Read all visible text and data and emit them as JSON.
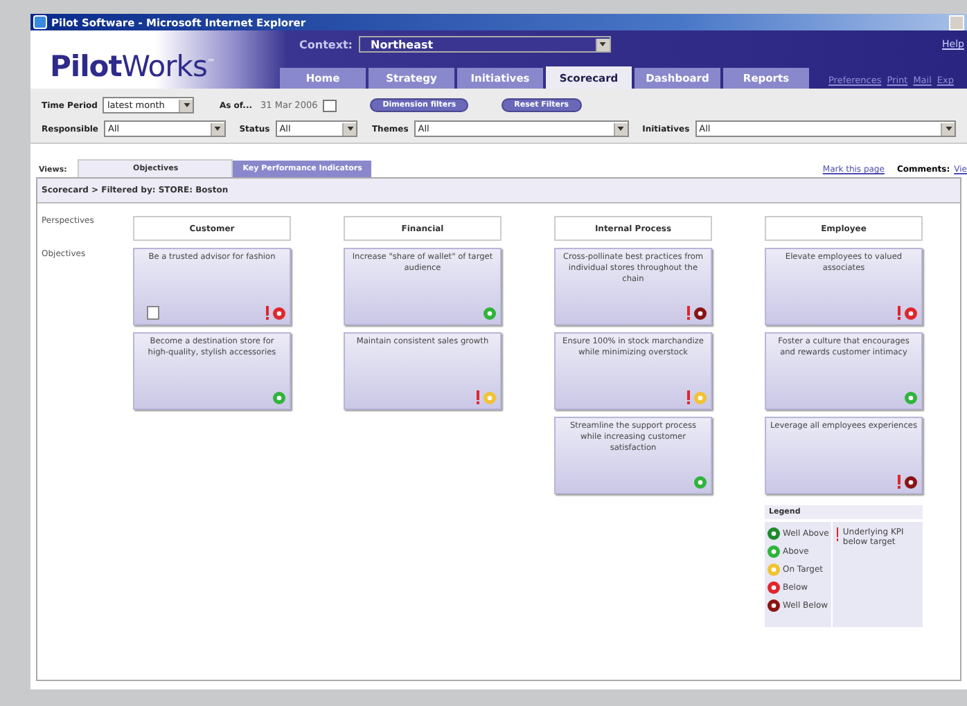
{
  "window": {
    "title": "Pilot Software - Microsoft Internet Explorer"
  },
  "header": {
    "logo_bold": "Pilot",
    "logo_light": "Works",
    "logo_mark": "™",
    "context_label": "Context:",
    "context_value": "Northeast",
    "help": "Help",
    "tabs": [
      {
        "label": "Home",
        "selected": false
      },
      {
        "label": "Strategy",
        "selected": false
      },
      {
        "label": "Initiatives",
        "selected": false
      },
      {
        "label": "Scorecard",
        "selected": true
      },
      {
        "label": "Dashboard",
        "selected": false
      },
      {
        "label": "Reports",
        "selected": false
      }
    ],
    "links": [
      "Preferences",
      "Print",
      "Mail",
      "Exp"
    ]
  },
  "filters": {
    "time_period": {
      "label": "Time Period",
      "value": "latest month"
    },
    "as_of": {
      "label": "As of...",
      "value": "31 Mar 2006"
    },
    "buttons": [
      "Dimension filters",
      "Reset Filters"
    ],
    "dropdowns": [
      {
        "label": "Responsible",
        "value": "All"
      },
      {
        "label": "Status",
        "value": "All"
      },
      {
        "label": "Themes",
        "value": "All"
      },
      {
        "label": "Initiatives",
        "value": "All"
      }
    ]
  },
  "views": {
    "label": "Views:",
    "tabs": [
      {
        "label": "Objectives",
        "selected": true
      },
      {
        "label": "Key Performance Indicators",
        "selected": false
      }
    ],
    "mark_link": "Mark this page",
    "comments_label": "Comments:",
    "comments_link": "Vie"
  },
  "breadcrumb": "Scorecard > Filtered by: STORE: Boston",
  "row_labels": [
    "Perspectives",
    "Objectives"
  ],
  "perspectives": [
    {
      "name": "Customer",
      "objectives": [
        {
          "text": "Be a trusted advisor for fashion",
          "note": true,
          "alert": true,
          "color": "#e0262c"
        },
        {
          "text": "Become a destination store for high-quality, stylish accessories",
          "note": false,
          "alert": false,
          "color": "#2fb43c"
        }
      ]
    },
    {
      "name": "Financial",
      "objectives": [
        {
          "text": "Increase \"share of wallet\" of target audience",
          "note": false,
          "alert": false,
          "color": "#2fb43c"
        },
        {
          "text": "Maintain consistent sales growth",
          "note": false,
          "alert": true,
          "color": "#f2c230"
        }
      ]
    },
    {
      "name": "Internal Process",
      "objectives": [
        {
          "text": "Cross-pollinate best practices from individual stores throughout the chain",
          "note": false,
          "alert": true,
          "color": "#8a1414"
        },
        {
          "text": "Ensure 100% in stock marchandize while minimizing overstock",
          "note": false,
          "alert": true,
          "color": "#f2c230"
        },
        {
          "text": "Streamline the support process while increasing customer satisfaction",
          "note": false,
          "alert": false,
          "color": "#2fb43c"
        }
      ]
    },
    {
      "name": "Employee",
      "objectives": [
        {
          "text": "Elevate employees to valued associates",
          "note": false,
          "alert": true,
          "color": "#e0262c"
        },
        {
          "text": "Foster a culture that encourages and rewards customer intimacy",
          "note": false,
          "alert": false,
          "color": "#2fb43c"
        },
        {
          "text": "Leverage all employees experiences",
          "note": false,
          "alert": true,
          "color": "#8a1414"
        }
      ]
    }
  ],
  "legend": {
    "title": "Legend",
    "items": [
      {
        "color": "#1f8a2e",
        "label": "Well Above"
      },
      {
        "color": "#2fb43c",
        "label": "Above"
      },
      {
        "color": "#f2c230",
        "label": "On Target"
      },
      {
        "color": "#e0262c",
        "label": "Below"
      },
      {
        "color": "#8a1414",
        "label": "Well Below"
      }
    ],
    "alert_label": "Underlying KPI below target"
  }
}
